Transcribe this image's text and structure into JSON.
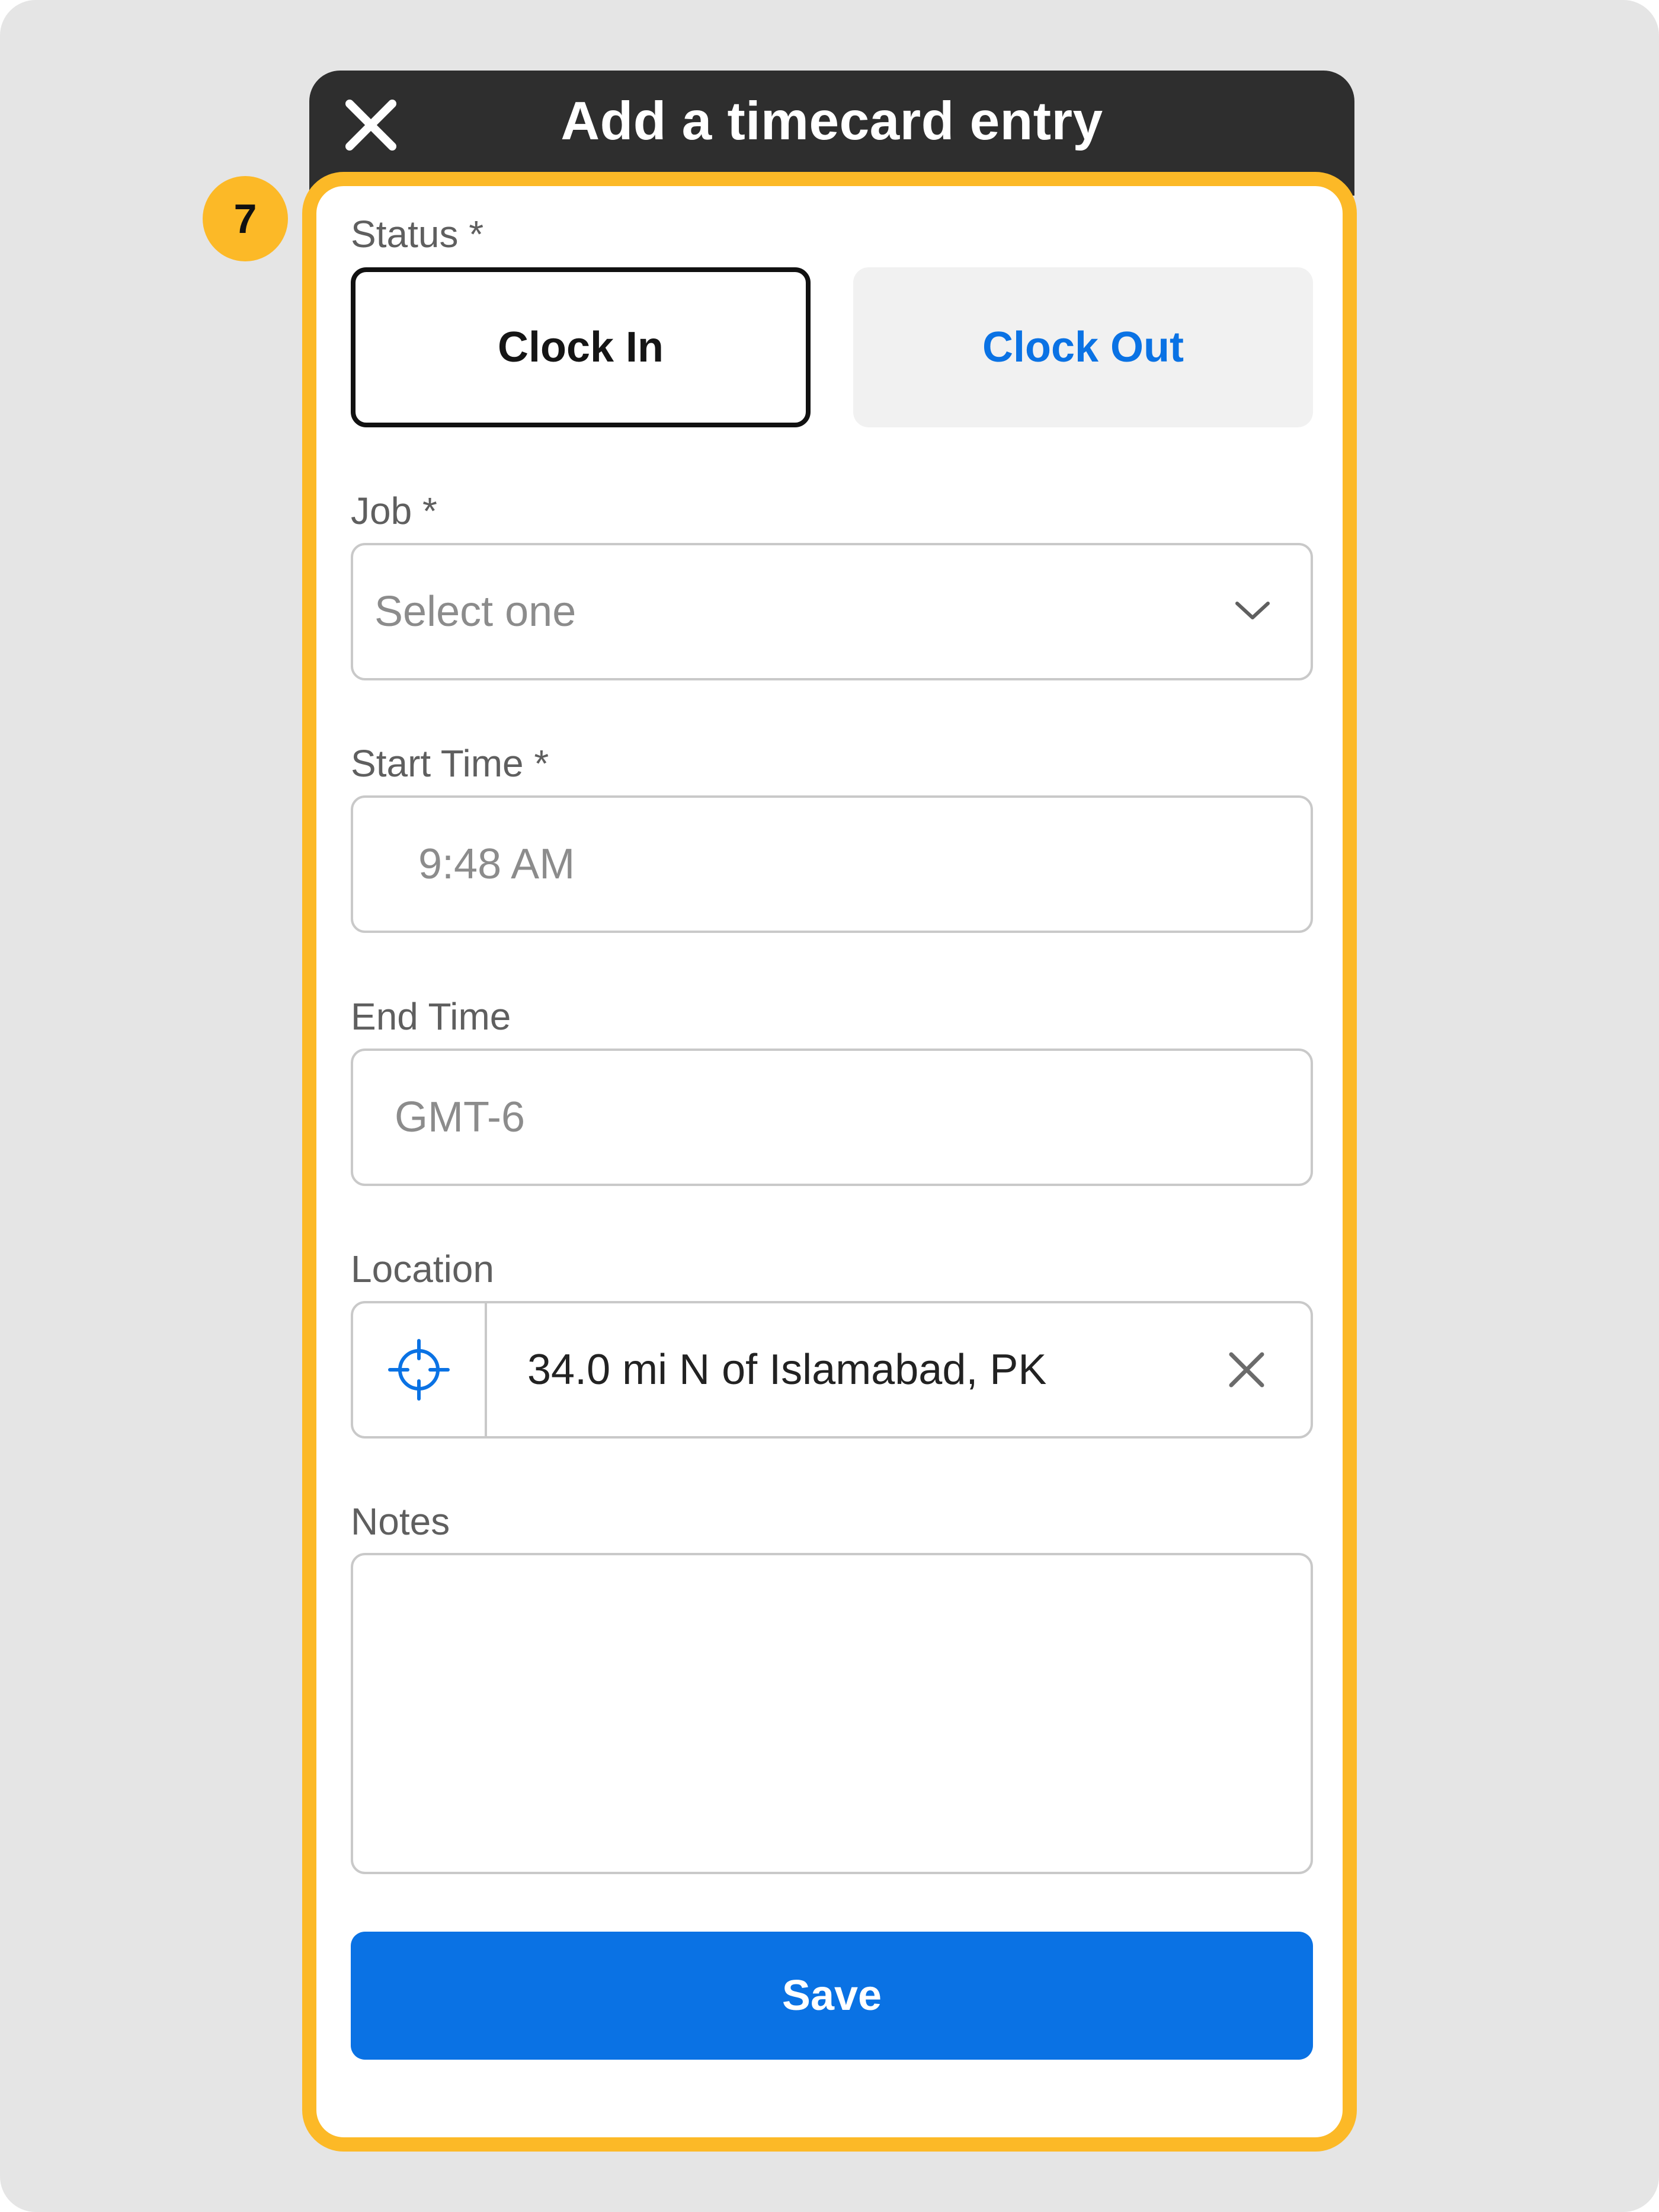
{
  "header": {
    "title": "Add a timecard entry",
    "close_icon": "close-icon"
  },
  "badge": {
    "number": "7"
  },
  "form": {
    "status": {
      "label": "Status *",
      "options": [
        "Clock In",
        "Clock Out"
      ],
      "selected": "Clock In"
    },
    "job": {
      "label": "Job *",
      "placeholder": "Select one",
      "icon": "chevron-down-icon"
    },
    "start_time": {
      "label": "Start Time *",
      "value": "9:48 AM"
    },
    "end_time": {
      "label": "End Time",
      "value": "GMT-6"
    },
    "location": {
      "label": "Location",
      "value": "34.0 mi N of Islamabad, PK",
      "locate_icon": "crosshair-icon",
      "clear_icon": "close-icon"
    },
    "notes": {
      "label": "Notes",
      "value": ""
    },
    "save_label": "Save"
  },
  "colors": {
    "accent": "#0a72e4",
    "highlight": "#fcb927",
    "header_bg": "#2e2e2e",
    "page_bg": "#e5e5e5"
  }
}
